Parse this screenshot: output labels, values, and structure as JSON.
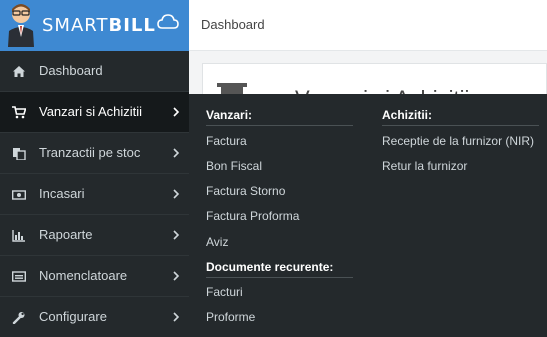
{
  "brand": {
    "text_regular": "SMART",
    "text_bold": "BILL"
  },
  "header": {
    "title": "Dashboard"
  },
  "main": {
    "panel_title": "Vanzari si Achizitii"
  },
  "sidebar": {
    "items": [
      {
        "label": "Dashboard",
        "icon": "home-icon"
      },
      {
        "label": "Vanzari si Achizitii",
        "icon": "cart-icon",
        "active": true
      },
      {
        "label": "Tranzactii pe stoc",
        "icon": "copy-icon"
      },
      {
        "label": "Incasari",
        "icon": "money-icon"
      },
      {
        "label": "Rapoarte",
        "icon": "bar-chart-icon"
      },
      {
        "label": "Nomenclatoare",
        "icon": "list-icon"
      },
      {
        "label": "Configurare",
        "icon": "wrench-icon"
      }
    ]
  },
  "dropdown": {
    "vanzari": {
      "heading": "Vanzari:",
      "items": [
        "Factura",
        "Bon Fiscal",
        "Factura Storno",
        "Factura Proforma",
        "Aviz"
      ]
    },
    "recurente": {
      "heading": "Documente recurente:",
      "items": [
        "Facturi",
        "Proforme"
      ]
    },
    "achizitii": {
      "heading": "Achizitii:",
      "items": [
        "Receptie de la furnizor (NIR)",
        "Retur la furnizor"
      ]
    }
  },
  "colors": {
    "brand_blue": "#3e89d2",
    "sidebar_bg": "#24292c",
    "sidebar_active": "#15191b",
    "content_bg": "#f3f4f5"
  }
}
